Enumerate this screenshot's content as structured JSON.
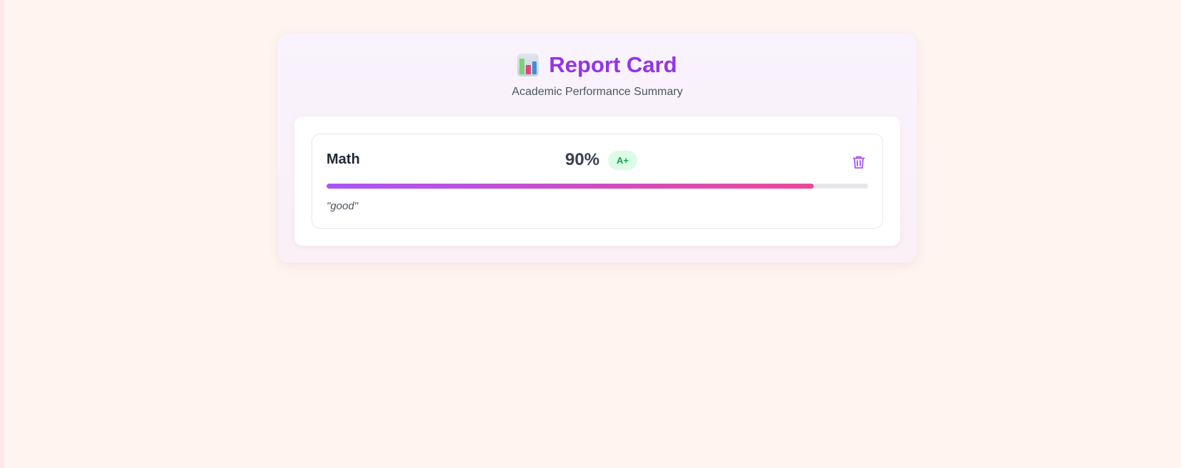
{
  "header": {
    "icon": "bar-chart-icon",
    "title": "Report Card",
    "subtitle": "Academic Performance Summary"
  },
  "subjects": [
    {
      "name": "Math",
      "score_label": "90%",
      "score_value": 90,
      "grade": "A+",
      "comment": "\"good\"",
      "delete_icon": "trash-icon"
    }
  ],
  "colors": {
    "accent": "#9333ea",
    "progress_start": "#a855f7",
    "progress_end": "#ec4899",
    "grade_bg": "#dcfce7",
    "grade_text": "#16a34a"
  }
}
